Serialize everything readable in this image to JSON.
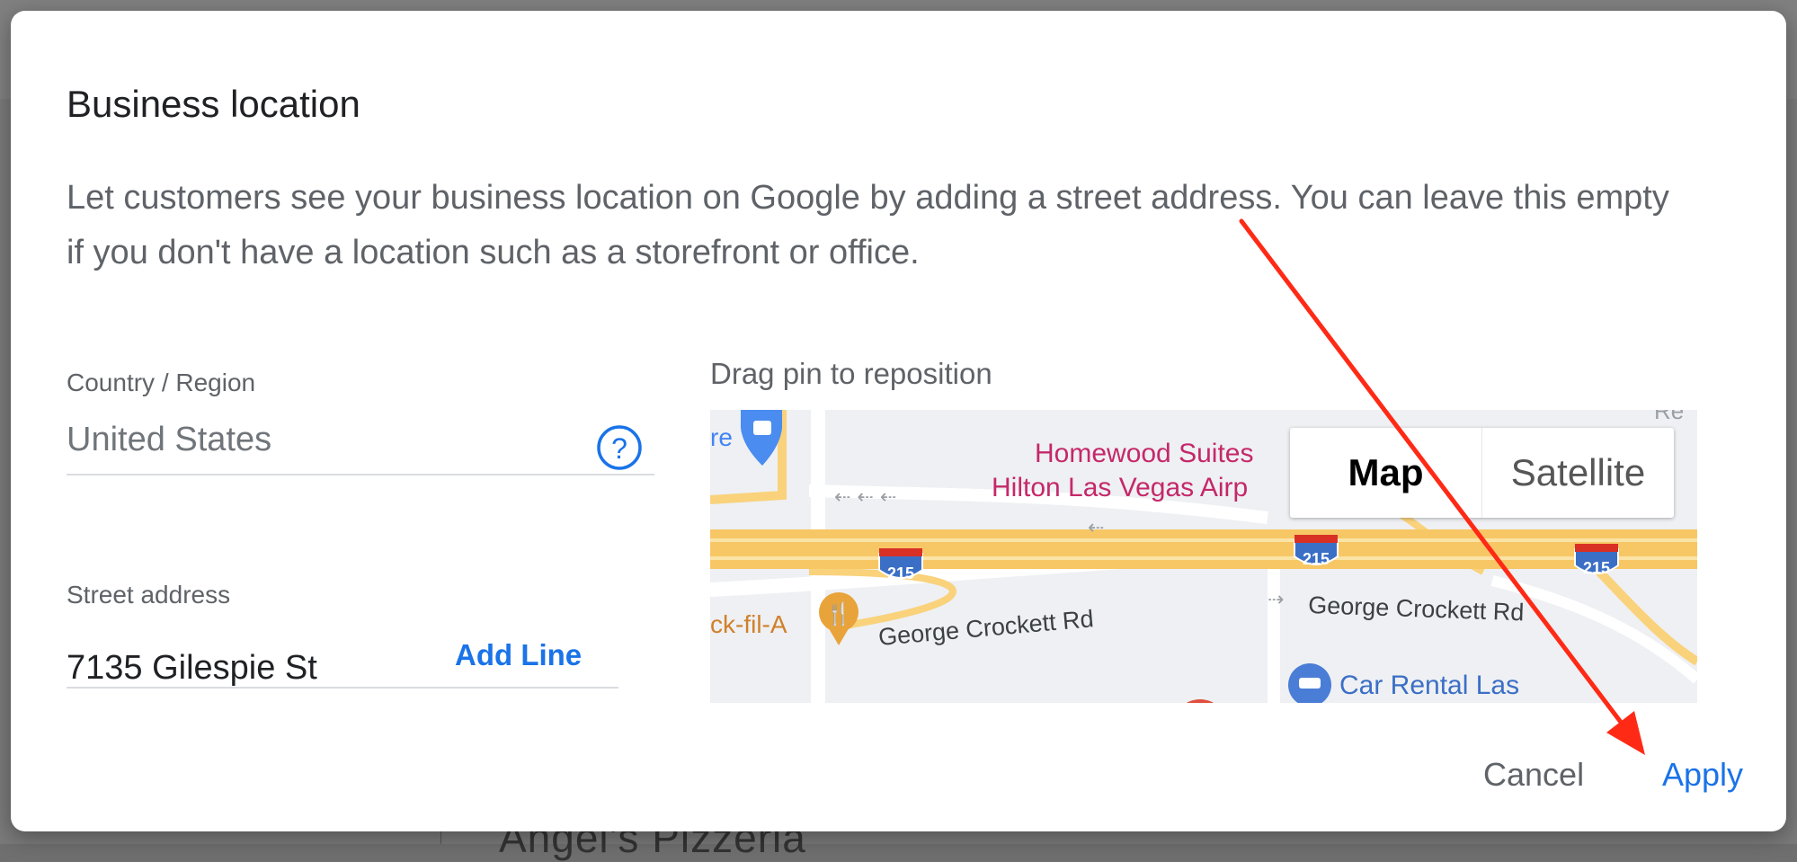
{
  "background": {
    "title_fragment": "Angel's Pizzeria"
  },
  "dialog": {
    "title": "Business location",
    "description": "Let customers see your business location on Google by adding a street address. You can leave this empty if you don't have a location such as a storefront or office."
  },
  "country": {
    "label": "Country / Region",
    "value": "United States",
    "help_icon": "question-circle-icon"
  },
  "street": {
    "label": "Street address",
    "value": "7135 Gilespie St",
    "add_line_label": "Add Line"
  },
  "map": {
    "caption": "Drag pin to reposition",
    "toggle": [
      "Map",
      "Satellite"
    ],
    "selected": "Map",
    "labels": {
      "hotel_line1": "Homewood Suites",
      "hotel_line2": "Hilton Las Vegas Airp",
      "road_west": "George Crockett Rd",
      "road_east": "George Crockett Rd",
      "restaurant": "ck-fil-A",
      "car_rental": "Car Rental Las",
      "shop_fragment": "re",
      "top_right_fragment": "Re",
      "interstate": "215"
    }
  },
  "actions": {
    "cancel": "Cancel",
    "apply": "Apply"
  },
  "colors": {
    "accent": "#1a73e8",
    "annotation_arrow": "#ff2a16",
    "highway": "#f9d27b",
    "poi_pink": "#c5286a"
  }
}
